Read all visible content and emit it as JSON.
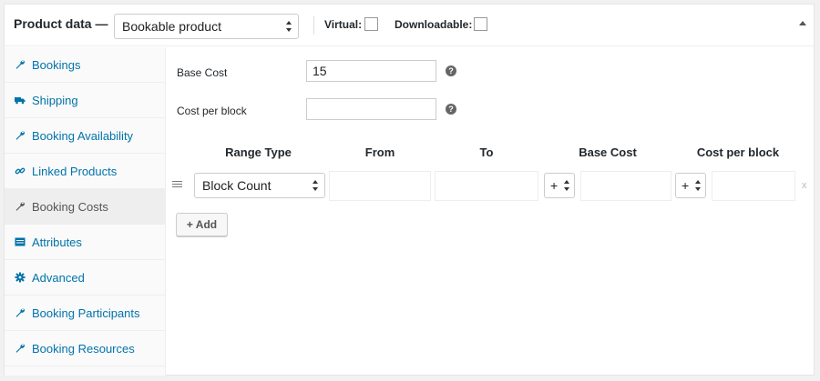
{
  "header": {
    "title": "Product data —",
    "product_type": "Bookable product",
    "virtual_label": "Virtual:",
    "downloadable_label": "Downloadable:"
  },
  "sidebar": {
    "items": [
      {
        "label": "Bookings",
        "icon": "wrench-icon",
        "active": false
      },
      {
        "label": "Shipping",
        "icon": "truck-icon",
        "active": false
      },
      {
        "label": "Booking Availability",
        "icon": "wrench-icon",
        "active": false
      },
      {
        "label": "Linked Products",
        "icon": "link-icon",
        "active": false
      },
      {
        "label": "Booking Costs",
        "icon": "wrench-icon",
        "active": true
      },
      {
        "label": "Attributes",
        "icon": "table-icon",
        "active": false
      },
      {
        "label": "Advanced",
        "icon": "gear-icon",
        "active": false
      },
      {
        "label": "Booking Participants",
        "icon": "wrench-icon",
        "active": false
      },
      {
        "label": "Booking Resources",
        "icon": "wrench-icon",
        "active": false
      }
    ]
  },
  "costs": {
    "base_cost_label": "Base Cost",
    "base_cost_value": "15",
    "cost_per_block_label": "Cost per block",
    "cost_per_block_value": "",
    "help_glyph": "?"
  },
  "table": {
    "headers": [
      "Range Type",
      "From",
      "To",
      "Base Cost",
      "Cost per block"
    ],
    "row": {
      "range_type": "Block Count",
      "base_operator": "+",
      "block_operator": "+",
      "remove": "x"
    },
    "add_label": "+ Add"
  },
  "colors": {
    "link": "#0073aa",
    "active_bg": "#eeeeee",
    "text": "#23282d"
  }
}
